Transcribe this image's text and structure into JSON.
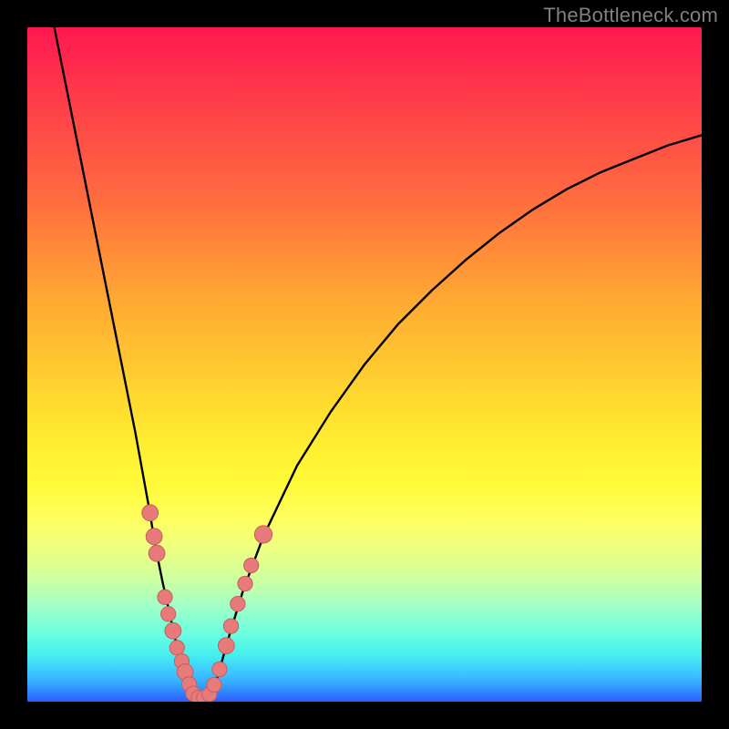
{
  "watermark": "TheBottleneck.com",
  "colors": {
    "curve": "#000000",
    "marker_fill": "#e77a7b",
    "marker_stroke": "#c75d5e",
    "bg_black": "#000000"
  },
  "chart_data": {
    "type": "line",
    "title": "",
    "xlabel": "",
    "ylabel": "",
    "xlim": [
      0,
      100
    ],
    "ylim": [
      0,
      100
    ],
    "grid": false,
    "legend": false,
    "curve_left": {
      "x": [
        4.0,
        6.0,
        8.0,
        10.0,
        12.0,
        14.0,
        16.0,
        18.0,
        19.0,
        20.0,
        21.0,
        22.0,
        23.0,
        24.0,
        24.6
      ],
      "y": [
        100.0,
        90.0,
        80.0,
        70.0,
        60.0,
        50.0,
        40.0,
        29.0,
        23.0,
        18.0,
        13.5,
        9.0,
        5.5,
        2.5,
        0.5
      ]
    },
    "curve_right": {
      "x": [
        27.2,
        28.0,
        29.0,
        30.0,
        32.0,
        35.0,
        40.0,
        45.0,
        50.0,
        55.0,
        60.0,
        65.0,
        70.0,
        75.0,
        80.0,
        85.0,
        90.0,
        95.0,
        100.0
      ],
      "y": [
        1.0,
        3.0,
        6.5,
        10.0,
        16.5,
        24.5,
        35.0,
        43.0,
        50.0,
        56.0,
        61.0,
        65.5,
        69.5,
        73.0,
        76.0,
        78.5,
        80.5,
        82.5,
        84.0
      ]
    },
    "floor_segment": {
      "x": [
        24.6,
        27.2
      ],
      "y": [
        0.5,
        1.0
      ]
    },
    "markers": [
      {
        "x": 18.2,
        "y": 28.0,
        "r": 1.2
      },
      {
        "x": 18.8,
        "y": 24.5,
        "r": 1.2
      },
      {
        "x": 19.2,
        "y": 22.0,
        "r": 1.2
      },
      {
        "x": 20.4,
        "y": 15.5,
        "r": 1.1
      },
      {
        "x": 20.9,
        "y": 13.0,
        "r": 1.1
      },
      {
        "x": 21.6,
        "y": 10.5,
        "r": 1.2
      },
      {
        "x": 22.2,
        "y": 8.0,
        "r": 1.1
      },
      {
        "x": 22.9,
        "y": 6.0,
        "r": 1.1
      },
      {
        "x": 23.4,
        "y": 4.4,
        "r": 1.2
      },
      {
        "x": 24.0,
        "y": 2.6,
        "r": 1.1
      },
      {
        "x": 24.6,
        "y": 1.2,
        "r": 1.1
      },
      {
        "x": 25.4,
        "y": 0.6,
        "r": 1.1
      },
      {
        "x": 26.2,
        "y": 0.6,
        "r": 1.1
      },
      {
        "x": 27.0,
        "y": 1.1,
        "r": 1.1
      },
      {
        "x": 27.7,
        "y": 2.5,
        "r": 1.1
      },
      {
        "x": 28.5,
        "y": 4.8,
        "r": 1.1
      },
      {
        "x": 29.5,
        "y": 8.3,
        "r": 1.2
      },
      {
        "x": 30.2,
        "y": 11.2,
        "r": 1.1
      },
      {
        "x": 31.2,
        "y": 14.5,
        "r": 1.1
      },
      {
        "x": 32.3,
        "y": 17.5,
        "r": 1.1
      },
      {
        "x": 33.2,
        "y": 20.2,
        "r": 1.1
      },
      {
        "x": 35.0,
        "y": 24.8,
        "r": 1.3
      }
    ]
  }
}
